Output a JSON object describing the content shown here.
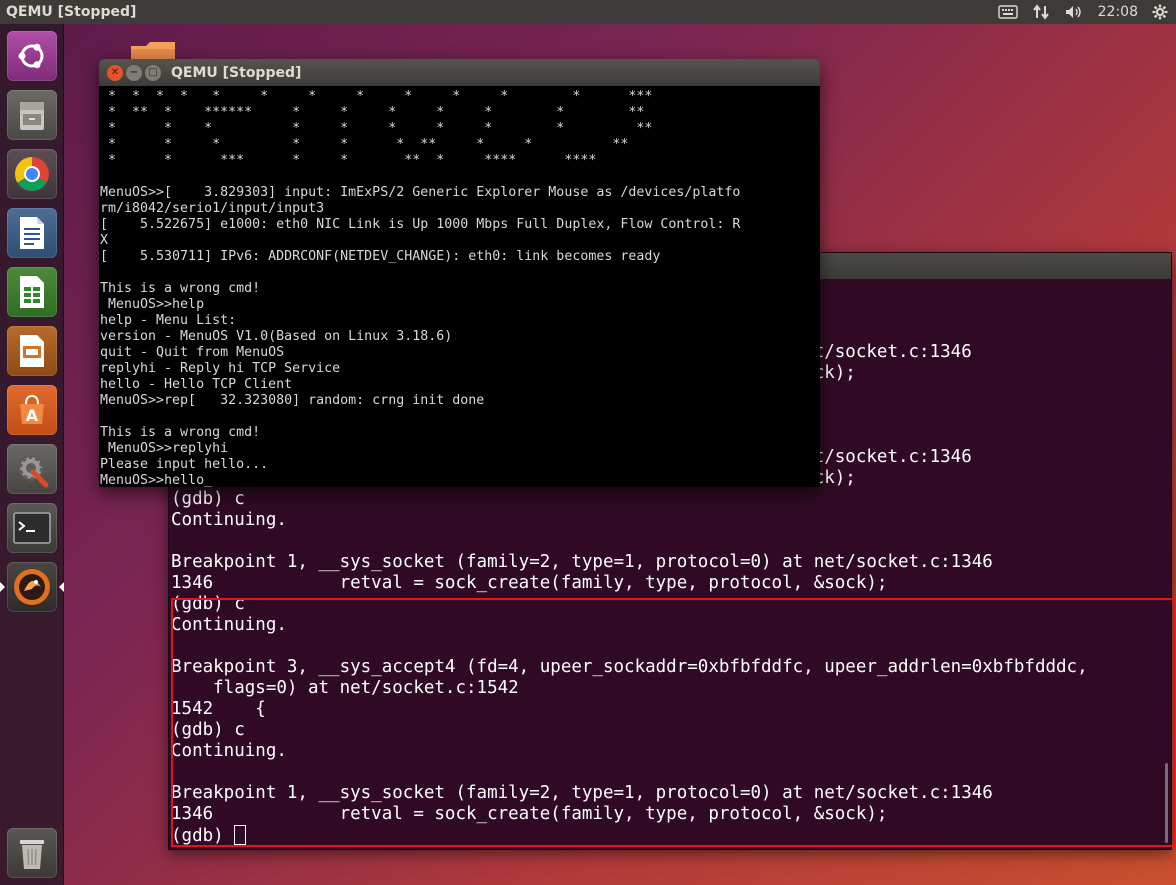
{
  "top_panel": {
    "title": "QEMU [Stopped]",
    "clock": "22:08"
  },
  "launcher": {
    "items": [
      {
        "name": "Ubuntu Dash"
      },
      {
        "name": "Files"
      },
      {
        "name": "Chromium Browser"
      },
      {
        "name": "LibreOffice Writer"
      },
      {
        "name": "LibreOffice Calc"
      },
      {
        "name": "LibreOffice Impress"
      },
      {
        "name": "Ubuntu Software"
      },
      {
        "name": "System Settings"
      },
      {
        "name": "Terminal"
      },
      {
        "name": "QEMU"
      },
      {
        "name": "Trash"
      }
    ]
  },
  "qemu": {
    "title": "QEMU [Stopped]",
    "lines": [
      " *  *  *  *   *     *     *     *     *     *     *        *      ***",
      " *  **  *    ******     *     *     *     *     *        *        **",
      " *      *    *          *     *     *     *     *        *         **",
      " *      *     *         *     *      *  **     *     *          **",
      " *      *      ***      *     *       **  *     ****      ****",
      "",
      "MenuOS>>[    3.829303] input: ImExPS/2 Generic Explorer Mouse as /devices/platfo",
      "rm/i8042/serio1/input/input3",
      "[    5.522675] e1000: eth0 NIC Link is Up 1000 Mbps Full Duplex, Flow Control: R",
      "X",
      "[    5.530711] IPv6: ADDRCONF(NETDEV_CHANGE): eth0: link becomes ready",
      "",
      "This is a wrong cmd!",
      " MenuOS>>help",
      "help - Menu List:",
      "version - MenuOS V1.0(Based on Linux 3.18.6)",
      "quit - Quit from MenuOS",
      "replyhi - Reply hi TCP Service",
      "hello - Hello TCP Client",
      "MenuOS>>rep[   32.323080] random: crng init done",
      "",
      "This is a wrong cmd!",
      " MenuOS>>replyhi",
      "Please input hello...",
      "MenuOS>>hello_"
    ]
  },
  "gdb": {
    "lines": [
      "",
      "",
      "",
      "                                                        at net/socket.c:1346",
      "                                                        , &sock);",
      "",
      "",
      "",
      "                                                        at net/socket.c:1346",
      "                                                        , &sock);",
      "(gdb) c",
      "Continuing.",
      "",
      "Breakpoint 1, __sys_socket (family=2, type=1, protocol=0) at net/socket.c:1346",
      "1346            retval = sock_create(family, type, protocol, &sock);",
      "(gdb) c",
      "Continuing.",
      "",
      "Breakpoint 3, __sys_accept4 (fd=4, upeer_sockaddr=0xbfbfddfc, upeer_addrlen=0xbfbfdddc,",
      "    flags=0) at net/socket.c:1542",
      "1542    {",
      "(gdb) c",
      "Continuing.",
      "",
      "Breakpoint 1, __sys_socket (family=2, type=1, protocol=0) at net/socket.c:1346",
      "1346            retval = sock_create(family, type, protocol, &sock);"
    ],
    "prompt": "(gdb) "
  },
  "colors": {
    "terminal_bg": "#300a24",
    "highlight": "#e0161b",
    "panel_bg": "#3c3b37"
  }
}
